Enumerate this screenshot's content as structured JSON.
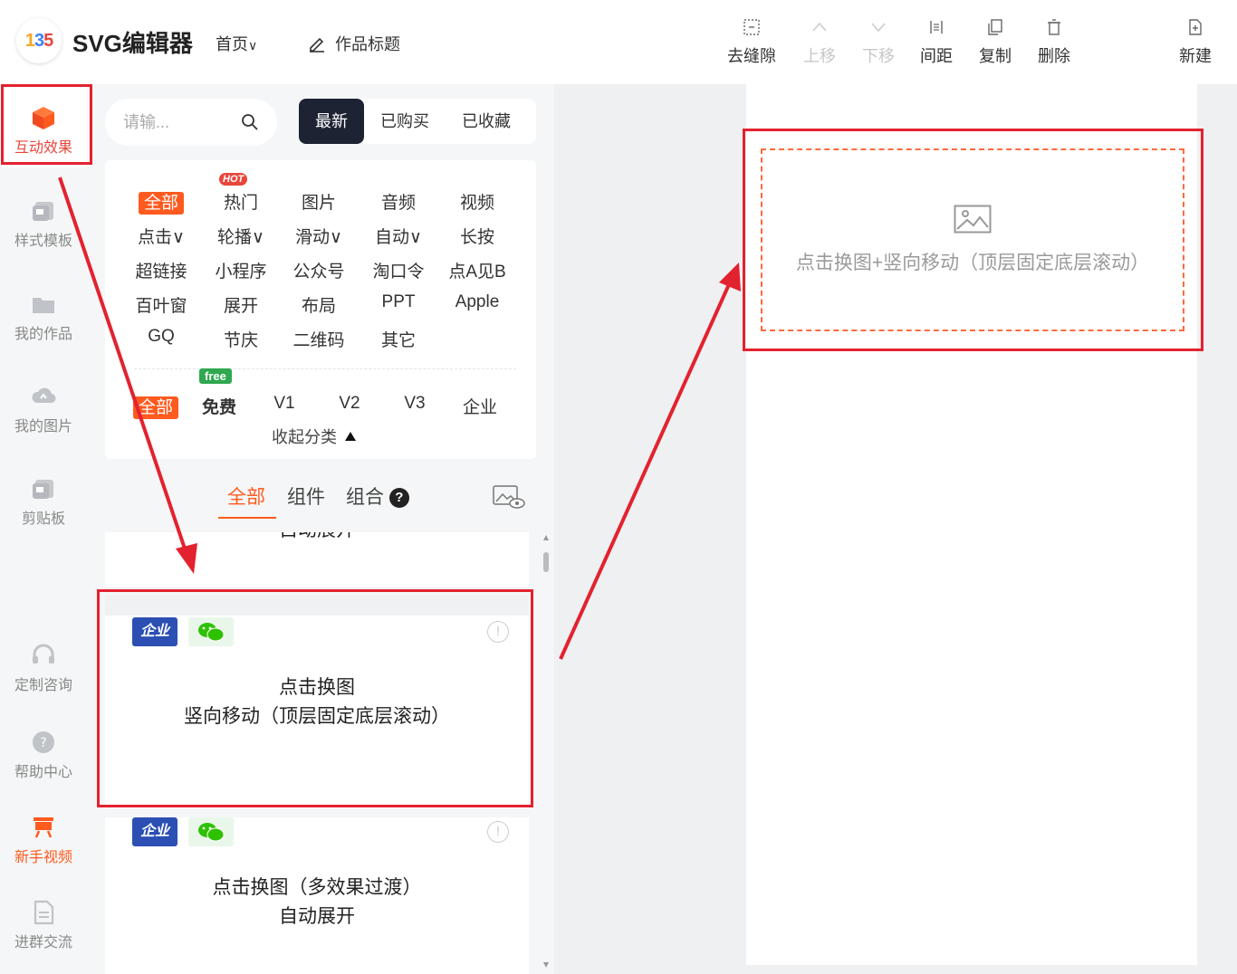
{
  "header": {
    "logo_text": "135",
    "app_title": "SVG编辑器",
    "home_menu": "首页",
    "work_title": "作品标题",
    "tools": [
      {
        "label": "去缝隙",
        "icon": "gap-icon",
        "enabled": true
      },
      {
        "label": "上移",
        "icon": "chevron-up-icon",
        "enabled": false
      },
      {
        "label": "下移",
        "icon": "chevron-down-icon",
        "enabled": false
      },
      {
        "label": "间距",
        "icon": "spacing-icon",
        "enabled": true
      },
      {
        "label": "复制",
        "icon": "copy-icon",
        "enabled": true
      },
      {
        "label": "删除",
        "icon": "trash-icon",
        "enabled": true
      },
      {
        "label": "新建",
        "icon": "new-file-icon",
        "enabled": true
      }
    ]
  },
  "rail": {
    "items": [
      {
        "label": "互动效果",
        "icon": "cube-icon",
        "state": "active"
      },
      {
        "label": "样式模板",
        "icon": "template-icon"
      },
      {
        "label": "我的作品",
        "icon": "folder-icon"
      },
      {
        "label": "我的图片",
        "icon": "cloud-upload-icon"
      },
      {
        "label": "剪贴板",
        "icon": "clipboard-icon"
      },
      {
        "label": "定制咨询",
        "icon": "headset-icon"
      },
      {
        "label": "帮助中心",
        "icon": "help-icon"
      },
      {
        "label": "新手视频",
        "icon": "video-icon",
        "state": "highlight"
      },
      {
        "label": "进群交流",
        "icon": "document-icon"
      }
    ]
  },
  "panel": {
    "search_placeholder": "请输...",
    "segments": [
      "最新",
      "已购买",
      "已收藏"
    ],
    "categories": {
      "row1": [
        "全部",
        "热门",
        "图片",
        "音频",
        "视频"
      ],
      "row2": [
        "点击∨",
        "轮播∨",
        "滑动∨",
        "自动∨",
        "长按"
      ],
      "row3": [
        "超链接",
        "小程序",
        "公众号",
        "淘口令",
        "点A见B"
      ],
      "row4": [
        "百叶窗",
        "展开",
        "布局",
        "PPT",
        "Apple"
      ],
      "row5": [
        "GQ",
        "节庆",
        "二维码",
        "其它"
      ],
      "hot_badge": "HOT",
      "price_row": [
        "全部",
        "免费",
        "V1",
        "V2",
        "V3",
        "企业"
      ],
      "free_badge": "free",
      "collapse": "收起分类"
    },
    "subtabs": [
      "全部",
      "组件",
      "组合"
    ],
    "help_mark": "?",
    "items": [
      {
        "title_lines": [
          "自动展开"
        ]
      },
      {
        "tags": [
          "企业",
          "wechat"
        ],
        "title_lines": [
          "点击换图",
          "竖向移动（顶层固定底层滚动）"
        ]
      },
      {
        "tags": [
          "企业",
          "wechat"
        ],
        "title_lines": [
          "点击换图（多效果过渡）",
          "自动展开"
        ]
      }
    ],
    "tag_label": "企业",
    "info_mark": "!"
  },
  "canvas": {
    "placeholder_text": "点击换图+竖向移动（顶层固定底层滚动）"
  },
  "colors": {
    "accent": "#ff5a1f",
    "annotation_red": "#e3222f",
    "dark_segment": "#1d2333"
  }
}
